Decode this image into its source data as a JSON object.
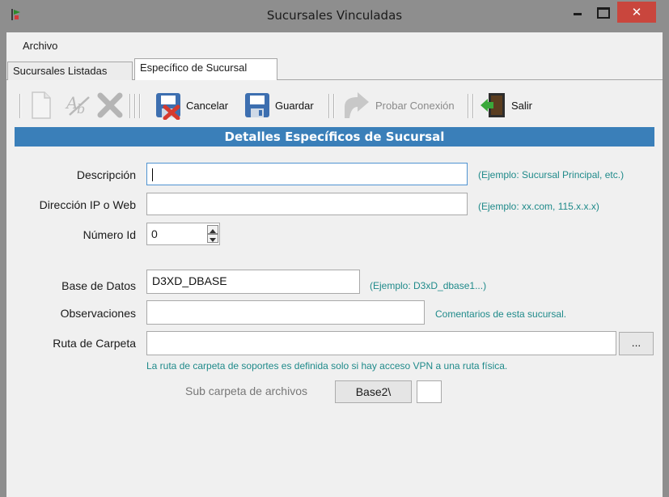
{
  "window": {
    "title": "Sucursales Vinculadas",
    "close_glyph": "✕"
  },
  "menu": {
    "archivo": "Archivo"
  },
  "tabs": [
    {
      "label": "Sucursales Listadas",
      "active": false
    },
    {
      "label": "Específico de Sucursal",
      "active": true
    }
  ],
  "toolbar": {
    "new_icon": "document-new-icon",
    "spell_icon": "spellcheck-icon",
    "delete_icon": "delete-x-icon",
    "cancel": "Cancelar",
    "save": "Guardar",
    "test": "Probar Conexión",
    "exit": "Salir"
  },
  "section_title": "Detalles Específicos de Sucursal",
  "form": {
    "descripcion": {
      "label": "Descripción",
      "value": "",
      "hint": "(Ejemplo: Sucursal Principal, etc.)"
    },
    "direccion": {
      "label": "Dirección IP o Web",
      "value": "",
      "hint": "(Ejemplo: xx.com, 115.x.x.x)"
    },
    "numero": {
      "label": "Número Id",
      "value": "0"
    },
    "base": {
      "label": "Base de Datos",
      "value": "D3XD_DBASE",
      "hint": "(Ejemplo: D3xD_dbase1...)"
    },
    "observaciones": {
      "label": "Observaciones",
      "value": "",
      "hint": "Comentarios de esta sucursal."
    },
    "ruta": {
      "label": "Ruta de Carpeta",
      "value": "",
      "browse": "...",
      "hint": "La ruta de carpeta de soportes es definida solo si hay acceso VPN a una ruta física."
    },
    "subcarpeta": {
      "label": "Sub carpeta de archivos",
      "button": "Base2\\",
      "value": ""
    }
  },
  "colors": {
    "banner": "#3a7fb9",
    "hint": "#1f8a8a",
    "titlebar": "#8e8e8e",
    "close": "#c9463d"
  }
}
